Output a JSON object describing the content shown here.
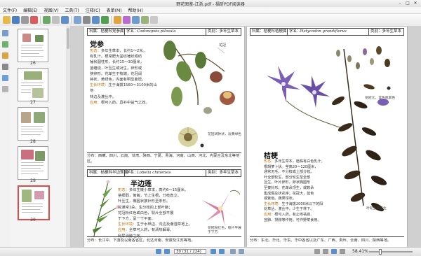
{
  "window": {
    "title": "野花图鉴-江浙.pdf - 福昕PDF阅读器"
  },
  "menu": [
    "文件(F)",
    "编辑(E)",
    "视图(V)",
    "工具(T)",
    "注释(C)",
    "表单(M)",
    "帮助(H)"
  ],
  "thumbnails": [
    {
      "label": "26"
    },
    {
      "label": "27"
    },
    {
      "label": "28"
    },
    {
      "label": "29"
    },
    {
      "label": "30"
    }
  ],
  "page_left": {
    "top": {
      "header": {
        "family": "科属：桔梗科党参属",
        "sci_label": "学名：",
        "sci_name": "Codonopsis pilosula",
        "type": "类别：多年生草本"
      },
      "title": "党参",
      "body": [
        {
          "k": "形态：",
          "t": "多年生草本，长约1～2米。"
        },
        {
          "k": "",
          "t": "有乳汁。根常肥大呈纺锤状或纺"
        },
        {
          "k": "",
          "t": "锤状圆柱形，长约15～30厘米，"
        },
        {
          "k": "",
          "t": "茎缠绕，叶互生或对生，卵形或"
        },
        {
          "k": "",
          "t": "狭卵形。花单生于枝端，花冠阔"
        },
        {
          "k": "",
          "t": "钟状，黄绿色，内面有明显紫斑。"
        },
        {
          "k": "生长环境：",
          "t": "生于海拔1560～3100米的山地"
        },
        {
          "k": "",
          "t": "林边及灌丛中。"
        },
        {
          "k": "应用：",
          "t": "根可入药，具补中益气之效。"
        }
      ],
      "caption": "花冠阔钟状，淡黄绿色",
      "footer": "分布：西藏、四川、云南、甘肃、陕西、宁夏、青海、河南、山西、河北、内蒙古及东北等地区。"
    },
    "bottom": {
      "header": {
        "family": "科属：桔梗科半边莲属",
        "sci_label": "学名：",
        "sci_name": "Lobelia chinensis",
        "type": "类别：多年生草本"
      },
      "title": "半边莲",
      "body": [
        {
          "k": "形态：",
          "t": "多年生矮小草本，高约6～15厘米。"
        },
        {
          "k": "",
          "t": "茎细弱，匍匐，节上生根，分枝直立。"
        },
        {
          "k": "",
          "t": "叶互生，椭圆状披针形至条形。"
        },
        {
          "k": "",
          "t": "花通常1朵，生分枝的上部叶腋；"
        },
        {
          "k": "",
          "t": "花冠粉红色或白色，裂片全部平展"
        },
        {
          "k": "",
          "t": "于下方，呈一个平面。"
        },
        {
          "k": "生长环境：",
          "t": "生于水田边、沟边及潮湿草地上。"
        },
        {
          "k": "应用：",
          "t": "全草可入药，有清热解毒、"
        },
        {
          "k": "",
          "t": "利尿消肿之效。"
        }
      ],
      "caption": "花冠粉红色，裂片平展于下方",
      "footer": "分布：长江中、下游及以南各省区，北达河南、安徽及江苏等地。"
    }
  },
  "page_right": {
    "header": {
      "family": "科属：桔梗科桔梗属",
      "sci_label": "学名：",
      "sci_name": "Platycodon grandiflorus",
      "type": "类别：多年生草本"
    },
    "title": "桔梗",
    "body": [
      {
        "k": "形态：",
        "t": "多年生草本，植株有白色乳汁。"
      },
      {
        "k": "",
        "t": "根胡萝卜状。茎高20～120厘米，"
      },
      {
        "k": "",
        "t": "通常无毛，不分枝或上部分枝。"
      },
      {
        "k": "",
        "t": "叶全部轮生、部分轮生至全部"
      },
      {
        "k": "",
        "t": "互生，叶片卵形，卵状椭圆形"
      },
      {
        "k": "",
        "t": "至披针形。花单朵顶生，或数朵"
      },
      {
        "k": "",
        "t": "集成假总状花序；花冠大，蓝色"
      },
      {
        "k": "",
        "t": "或紫色。蒴果球状。"
      },
      {
        "k": "生长环境：",
        "t": "生于海拔2000米以下的阳"
      },
      {
        "k": "",
        "t": "处草丛、灌丛中，少生于林下。"
      },
      {
        "k": "应用：",
        "t": "根可入药，有止咳祛痰、"
      },
      {
        "k": "",
        "t": "宣肺、排脓等作用，可作野菜食用。"
      }
    ],
    "caption_top": "花冠大，蓝色或紫色",
    "caption_bottom": "叶轮生或互生",
    "footer": "分布：东北、华北、华东、华中各省以及广东、广西、贵州、云南、四川、陕西等地。"
  },
  "statusbar": {
    "page_display": "30 (31 / 224)",
    "zoom": "58.41%"
  },
  "colors": {
    "accent": "#e04a4a",
    "title_text": "#111111",
    "highlight": "#c06f00"
  }
}
